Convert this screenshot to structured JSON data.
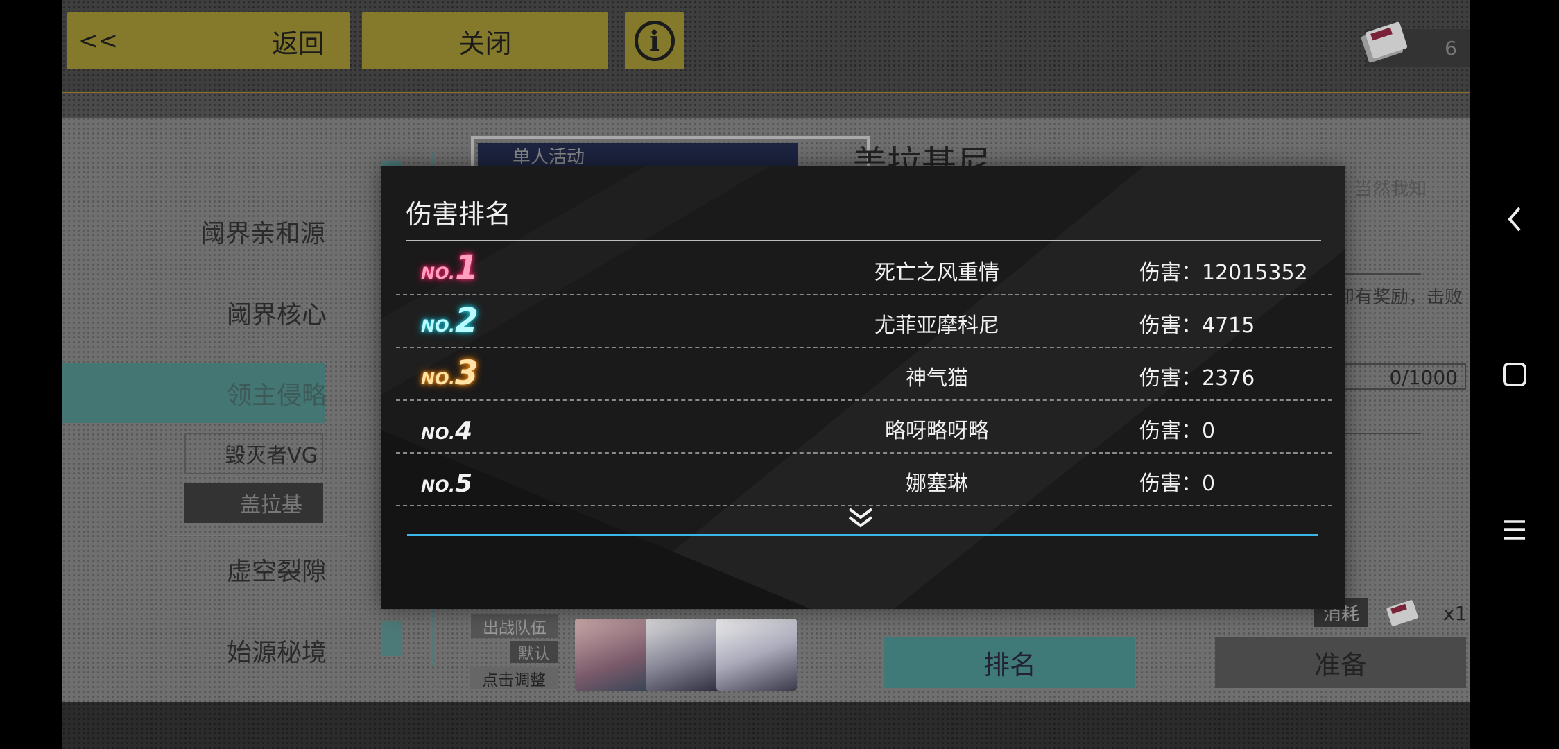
{
  "topbar": {
    "back_arrows": "<<",
    "back_label": "返回",
    "close_label": "关闭",
    "info_label": "i",
    "ticket_count": "6"
  },
  "menu": {
    "item1": "阈界亲和源",
    "item2": "阈界核心",
    "item3": "领主侵略",
    "sub1": "毁灭者VG",
    "sub2": "盖拉基",
    "item4": "虚空裂隙",
    "item5": "始源秘境"
  },
  "detail": {
    "card_tag": "单人活动",
    "boss_title": "盖拉基尼",
    "desc_line1": "吃海鲜，当然我知",
    "desc_line2": "与战斗即有奖励，击败",
    "progress_text": "0/1000",
    "progress_fraction": 0.0,
    "cost_label": "消耗",
    "cost_amount": "x1",
    "team_label": "出战队伍",
    "team_default": "默认",
    "team_adjust": "点击调整",
    "rank_button": "排名",
    "ready_button": "准备"
  },
  "modal": {
    "title": "伤害排名",
    "rows": [
      {
        "prefix": "NO.",
        "rank": "1",
        "name": "死亡之风重情",
        "damage": "伤害：12015352"
      },
      {
        "prefix": "NO.",
        "rank": "2",
        "name": "尤菲亚摩科尼",
        "damage": "伤害：4715"
      },
      {
        "prefix": "NO.",
        "rank": "3",
        "name": "神气猫",
        "damage": "伤害：2376"
      },
      {
        "prefix": "NO.",
        "rank": "4",
        "name": "略呀略呀略",
        "damage": "伤害：0"
      },
      {
        "prefix": "NO.",
        "rank": "5",
        "name": "娜塞琳",
        "damage": "伤害：0"
      }
    ]
  },
  "colors": {
    "accent_teal": "#3f7a78",
    "accent_gold": "#857a2c",
    "modal_bg": "#1a1a1a",
    "modal_blue_line": "#3cb6e8"
  },
  "icons": {
    "info": "info-icon",
    "ticket": "ticket-icon",
    "more": "double-chevron-down-icon",
    "nav_back": "back-icon",
    "nav_home": "square-home-icon",
    "nav_menu": "menu-icon"
  }
}
